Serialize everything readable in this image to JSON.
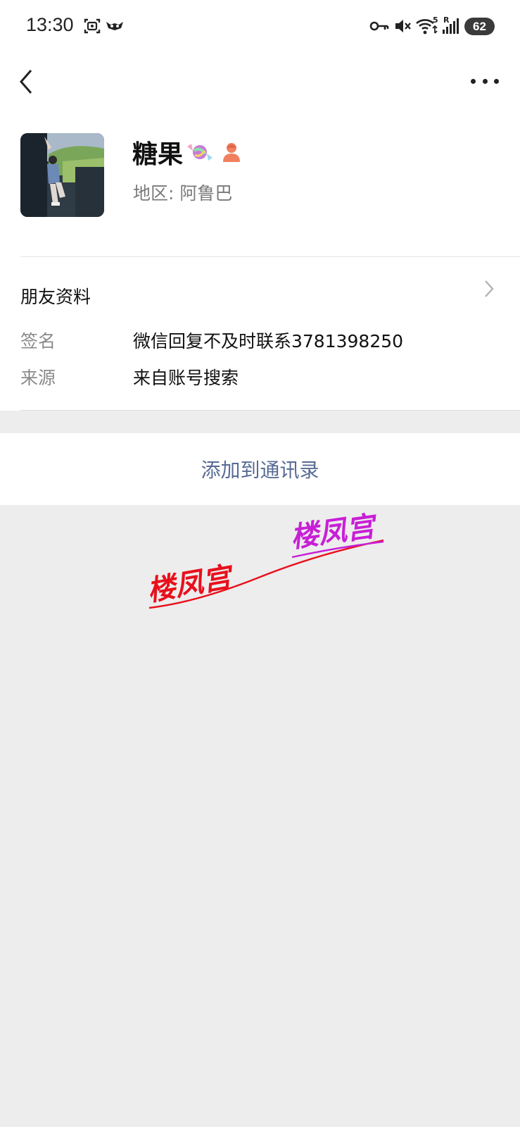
{
  "status_bar": {
    "time": "13:30",
    "network_gen": "5",
    "signal_label": "R",
    "battery": "62"
  },
  "profile": {
    "name": "糖果",
    "region": "地区: 阿鲁巴"
  },
  "friend_info": {
    "section_title": "朋友资料",
    "signature_label": "签名",
    "signature_value": "微信回复不及时联系3781398250",
    "source_label": "来源",
    "source_value": "来自账号搜索"
  },
  "actions": {
    "add_contact": "添加到通讯录"
  },
  "watermark": {
    "text": "楼凤宫",
    "color_1": "#e8101c",
    "color_2": "#c81fd6"
  },
  "colors": {
    "link": "#576b95",
    "background": "#ededed"
  }
}
